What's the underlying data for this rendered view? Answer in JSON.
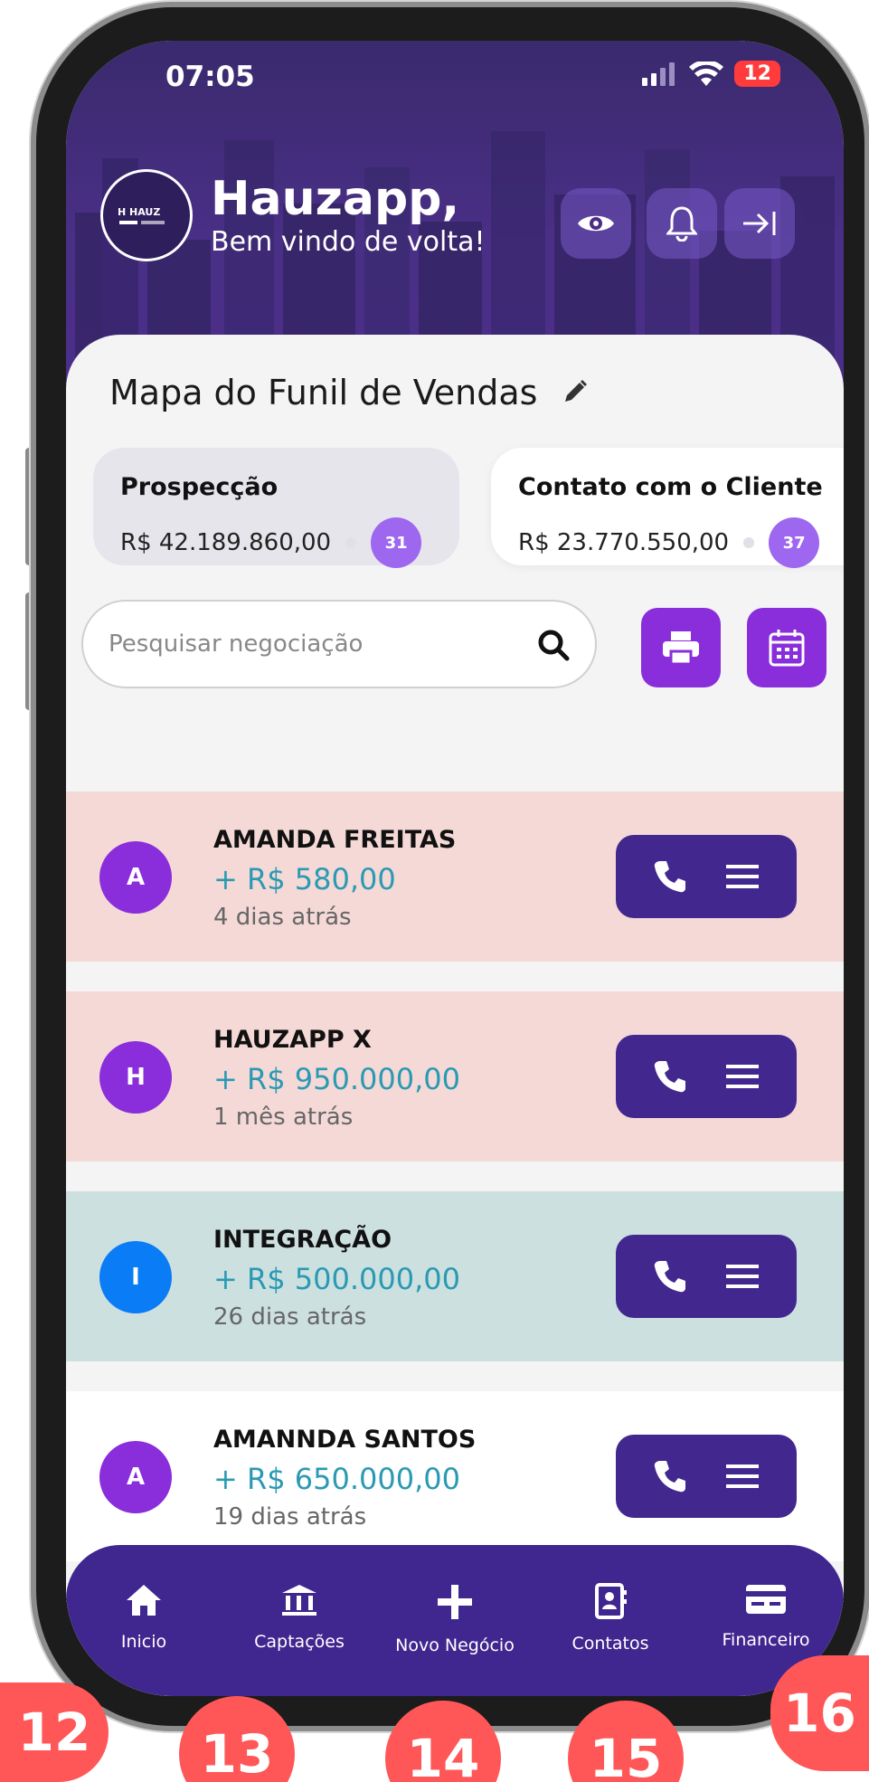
{
  "status": {
    "time": "07:05",
    "battery": "12"
  },
  "header": {
    "greeting": "Hauzapp,",
    "welcome": "Bem vindo de volta!"
  },
  "funnel": {
    "title": "Mapa do Funil de Vendas",
    "stages": [
      {
        "name": "Prospecção",
        "value": "R$ 42.189.860,00",
        "count": "31"
      },
      {
        "name": "Contato com o Cliente",
        "value": "R$ 23.770.550,00",
        "count": "37"
      }
    ]
  },
  "search": {
    "placeholder": "Pesquisar negociação"
  },
  "deals": [
    {
      "initial": "A",
      "name": "AMANDA FREITAS",
      "value": "+ R$ 580,00",
      "time": "4 dias atrás",
      "bg": "#f5d9d7",
      "avatar": "#8a2ddb"
    },
    {
      "initial": "H",
      "name": "HAUZAPP X",
      "value": "+ R$ 950.000,00",
      "time": "1 mês atrás",
      "bg": "#f5d9d7",
      "avatar": "#8a2ddb"
    },
    {
      "initial": "I",
      "name": "INTEGRAÇÃO",
      "value": "+ R$ 500.000,00",
      "time": "26 dias atrás",
      "bg": "#cde0e0",
      "avatar": "#0a7cf5"
    },
    {
      "initial": "A",
      "name": "AMANNDA SANTOS",
      "value": "+ R$ 650.000,00",
      "time": "19 dias atrás",
      "bg": "#ffffff",
      "avatar": "#8a2ddb"
    }
  ],
  "nav": {
    "items": [
      {
        "label": "Inicio",
        "icon": "home-icon"
      },
      {
        "label": "Captações",
        "icon": "bank-icon"
      },
      {
        "label": "Novo Negócio",
        "icon": "plus-icon"
      },
      {
        "label": "Contatos",
        "icon": "contacts-icon"
      },
      {
        "label": "Financeiro",
        "icon": "card-icon"
      }
    ]
  },
  "badges": [
    "12",
    "13",
    "14",
    "15",
    "16"
  ],
  "colors": {
    "primary": "#40268f",
    "accent": "#8a2ddb",
    "value": "#2a9ab3",
    "badge": "#ff5757"
  }
}
